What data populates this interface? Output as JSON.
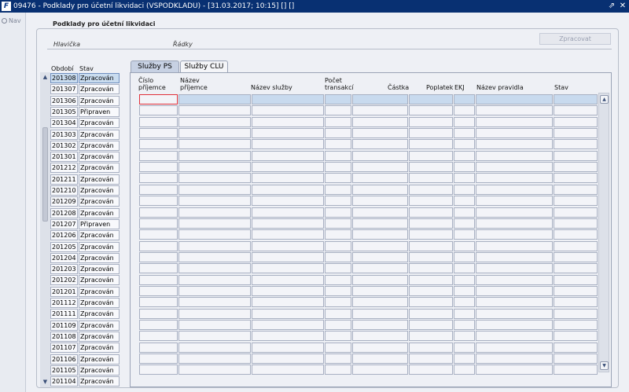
{
  "window": {
    "title": "09476 - Podklady pro účetní likvidaci (VSPODKLADU) - [31.03.2017; 10:15] [] []",
    "app_icon_letter": "F",
    "controls": [
      "⇗",
      "✕"
    ]
  },
  "nav": {
    "label": "Nav"
  },
  "section": {
    "legend": "Podklady pro účetní likvidaci",
    "header_label": "Hlavička",
    "rows_label": "Řádky",
    "process_button": "Zpracovat"
  },
  "left_table": {
    "columns": [
      "Období",
      "Stav"
    ],
    "selected_index": 0,
    "rows": [
      {
        "obdobi": "201308",
        "stav": "Zpracován"
      },
      {
        "obdobi": "201307",
        "stav": "Zpracován"
      },
      {
        "obdobi": "201306",
        "stav": "Zpracován"
      },
      {
        "obdobi": "201305",
        "stav": "Připraven"
      },
      {
        "obdobi": "201304",
        "stav": "Zpracován"
      },
      {
        "obdobi": "201303",
        "stav": "Zpracován"
      },
      {
        "obdobi": "201302",
        "stav": "Zpracován"
      },
      {
        "obdobi": "201301",
        "stav": "Zpracován"
      },
      {
        "obdobi": "201212",
        "stav": "Zpracován"
      },
      {
        "obdobi": "201211",
        "stav": "Zpracován"
      },
      {
        "obdobi": "201210",
        "stav": "Zpracován"
      },
      {
        "obdobi": "201209",
        "stav": "Zpracován"
      },
      {
        "obdobi": "201208",
        "stav": "Zpracován"
      },
      {
        "obdobi": "201207",
        "stav": "Připraven"
      },
      {
        "obdobi": "201206",
        "stav": "Zpracován"
      },
      {
        "obdobi": "201205",
        "stav": "Zpracován"
      },
      {
        "obdobi": "201204",
        "stav": "Zpracován"
      },
      {
        "obdobi": "201203",
        "stav": "Zpracován"
      },
      {
        "obdobi": "201202",
        "stav": "Zpracován"
      },
      {
        "obdobi": "201201",
        "stav": "Zpracován"
      },
      {
        "obdobi": "201112",
        "stav": "Zpracován"
      },
      {
        "obdobi": "201111",
        "stav": "Zpracován"
      },
      {
        "obdobi": "201109",
        "stav": "Zpracován"
      },
      {
        "obdobi": "201108",
        "stav": "Zpracován"
      },
      {
        "obdobi": "201107",
        "stav": "Zpracován"
      },
      {
        "obdobi": "201106",
        "stav": "Zpracován"
      },
      {
        "obdobi": "201105",
        "stav": "Zpracován"
      },
      {
        "obdobi": "201104",
        "stav": "Zpracován"
      }
    ]
  },
  "tabs": [
    {
      "label": "Služby PS",
      "active": true
    },
    {
      "label": "Služby CLU",
      "active": false
    }
  ],
  "grid": {
    "columns": [
      {
        "line1": "Číslo",
        "line2": "příjemce"
      },
      {
        "line1": "Název",
        "line2": "příjemce"
      },
      {
        "line1": "",
        "line2": "Název služby"
      },
      {
        "line1": "Počet",
        "line2": "transakcí"
      },
      {
        "line1": "",
        "line2": "Částka"
      },
      {
        "line1": "",
        "line2": "Poplatek"
      },
      {
        "line1": "",
        "line2": "EKJ"
      },
      {
        "line1": "",
        "line2": "Název pravidla"
      },
      {
        "line1": "",
        "line2": "Stav"
      }
    ],
    "visible_empty_rows": 25
  },
  "icons": {
    "scroll_up": "▲",
    "scroll_down": "▼",
    "nav": "nav-icon"
  },
  "colors": {
    "titlebar": "#083072",
    "selection": "#c9dcef",
    "focus_border": "#e0303a"
  }
}
